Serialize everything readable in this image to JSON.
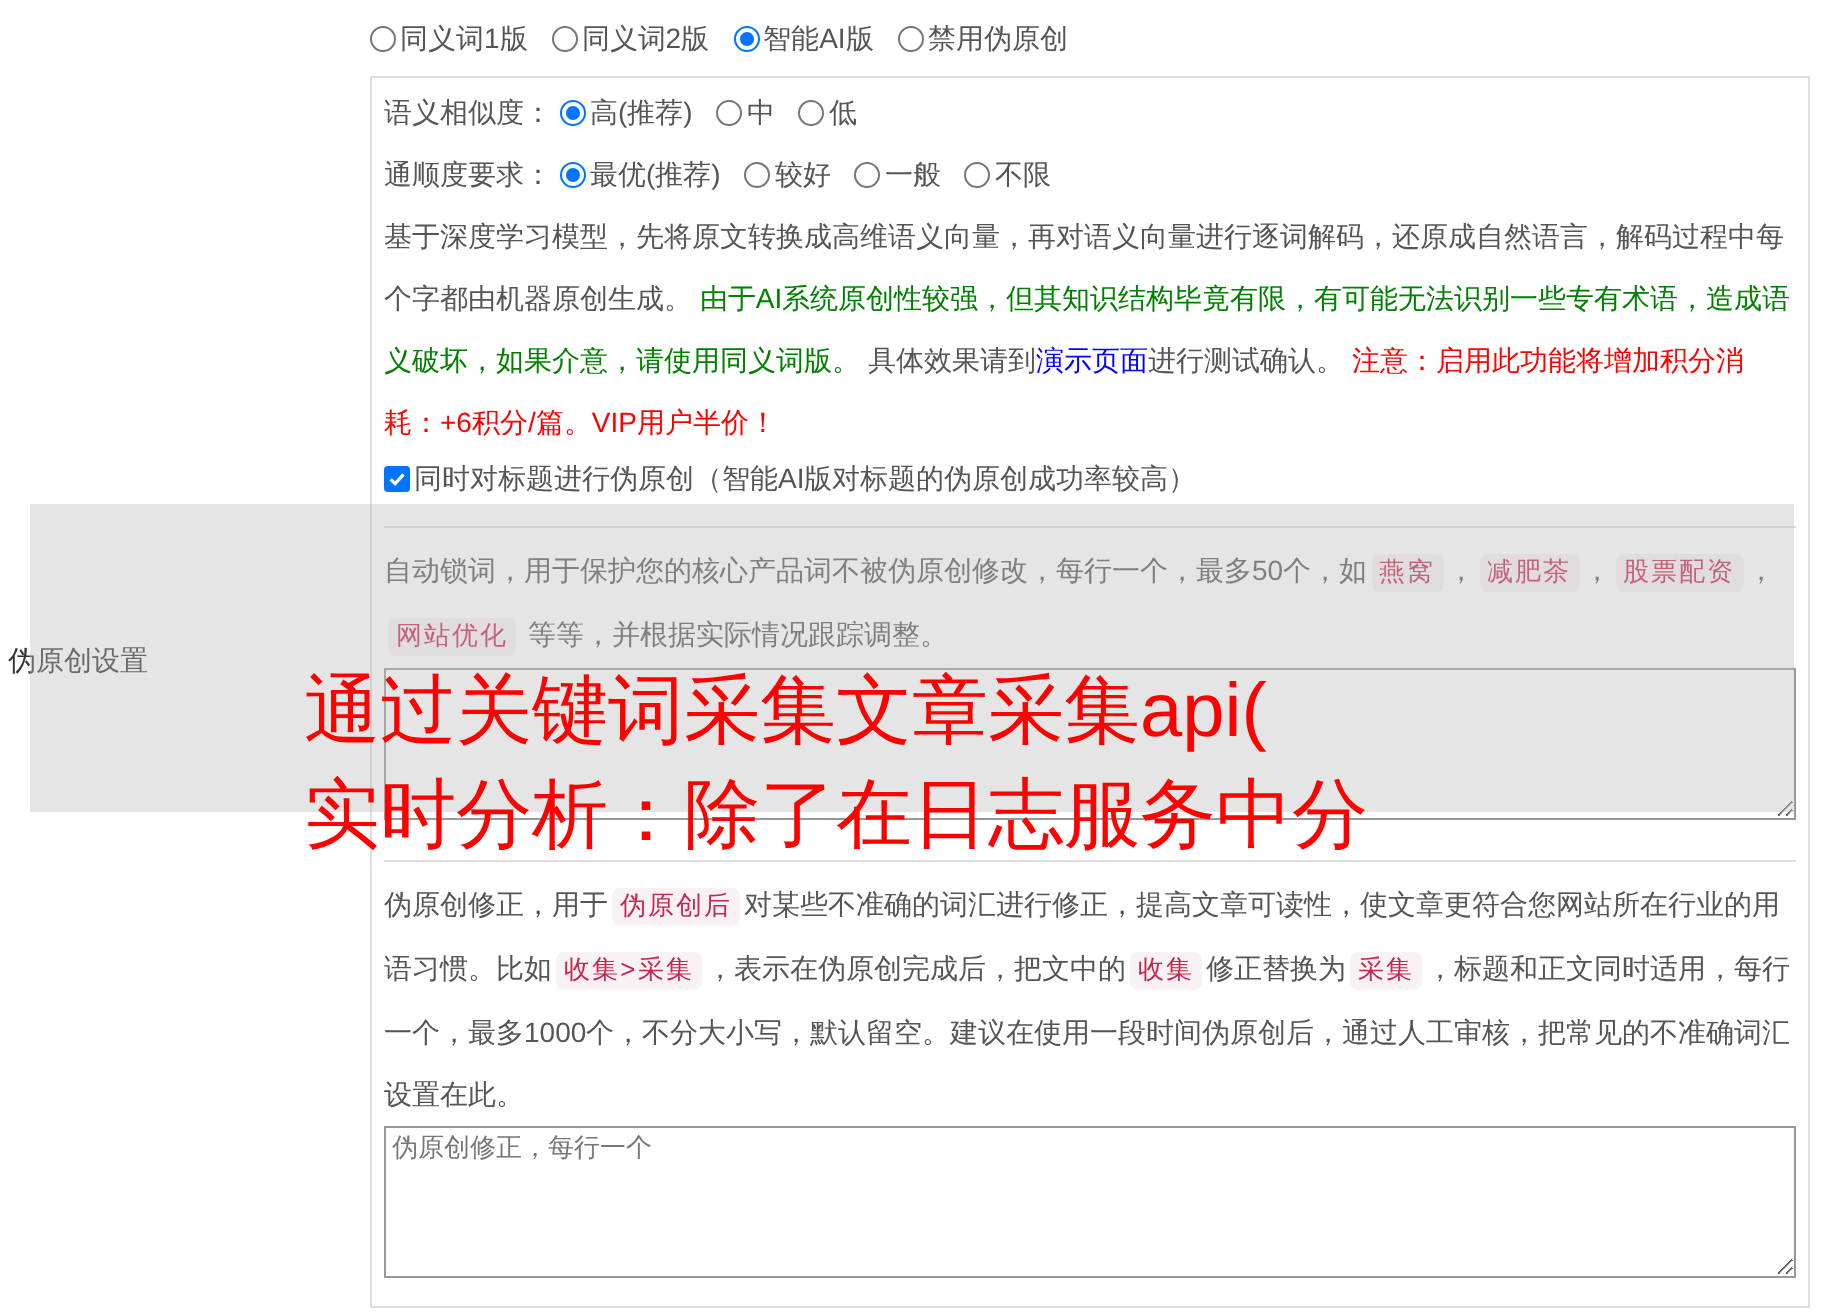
{
  "mode_options": [
    {
      "label": "同义词1版",
      "selected": false
    },
    {
      "label": "同义词2版",
      "selected": false
    },
    {
      "label": "智能AI版",
      "selected": true
    },
    {
      "label": "禁用伪原创",
      "selected": false
    }
  ],
  "ai_settings": {
    "groups": [
      {
        "label": "语义相似度：",
        "options": [
          {
            "label": "高(推荐)",
            "selected": true
          },
          {
            "label": "中",
            "selected": false
          },
          {
            "label": "低",
            "selected": false
          }
        ]
      },
      {
        "label": "通顺度要求：",
        "options": [
          {
            "label": "最优(推荐)",
            "selected": true
          },
          {
            "label": "较好",
            "selected": false
          },
          {
            "label": "一般",
            "selected": false
          },
          {
            "label": "不限",
            "selected": false
          }
        ]
      }
    ],
    "description": [
      {
        "kind": "text",
        "text": "基于深度学习模型，先将原文转换成高维语义向量，再对语义向量进行逐词解码，还原成自然语言，解码过程中每个字都由机器原创生成。 "
      },
      {
        "kind": "colored",
        "color": "#008000",
        "text": "由于AI系统原创性较强，但其知识结构毕竟有限，有可能无法识别一些专有术语，造成语义破坏，如果介意，请使用同义词版。"
      },
      {
        "kind": "text",
        "text": " 具体效果请到"
      },
      {
        "kind": "link",
        "text": "演示页面"
      },
      {
        "kind": "text",
        "text": "进行测试确认。 "
      },
      {
        "kind": "colored",
        "color": "#ff0000",
        "text": "注意：启用此功能将增加积分消耗：+6积分/篇。VIP用户半价！"
      }
    ],
    "title_option": {
      "label": "同时对标题进行伪原创（智能AI版对标题的伪原创成功率较高）",
      "checked": true
    }
  },
  "section_label": "伪原创设置",
  "lock_words": {
    "description": [
      {
        "kind": "text",
        "text": "自动锁词，用于保护您的核心产品词不被伪原创修改，每行一个，最多50个，如"
      },
      {
        "kind": "code",
        "text": "燕窝"
      },
      {
        "kind": "text",
        "text": "，"
      },
      {
        "kind": "code",
        "text": "减肥茶"
      },
      {
        "kind": "text",
        "text": "，"
      },
      {
        "kind": "code",
        "text": "股票配资"
      },
      {
        "kind": "text",
        "text": "，"
      },
      {
        "kind": "code",
        "text": "网站优化"
      },
      {
        "kind": "text",
        "text": " 等等，并根据实际情况跟踪调整。"
      }
    ]
  },
  "correction": {
    "description": [
      {
        "kind": "text",
        "text": "伪原创修正，用于"
      },
      {
        "kind": "code",
        "text": "伪原创后"
      },
      {
        "kind": "text",
        "text": "对某些不准确的词汇进行修正，提高文章可读性，使文章更符合您网站所在行业的用语习惯。比如"
      },
      {
        "kind": "code",
        "text": "收集>采集"
      },
      {
        "kind": "text",
        "text": "，表示在伪原创完成后，把文中的"
      },
      {
        "kind": "code",
        "text": "收集"
      },
      {
        "kind": "text",
        "text": "修正替换为"
      },
      {
        "kind": "code",
        "text": "采集"
      },
      {
        "kind": "text",
        "text": "，标题和正文同时适用，每行一个，最多1000个，不分大小写，默认留空。建议在使用一段时间伪原创后，通过人工审核，把常见的不准确词汇设置在此。"
      }
    ],
    "textarea": {
      "placeholder": "伪原创修正，每行一个"
    }
  },
  "overlay_title": [
    "通过关键词采集文章采集api(",
    "实时分析：除了在日志服务中分"
  ]
}
